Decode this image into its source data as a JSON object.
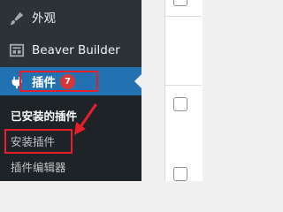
{
  "sidebar": {
    "appearance": {
      "label": "外观",
      "icon": "paintbrush-icon"
    },
    "beaver_builder": {
      "label": "Beaver Builder",
      "icon": "layout-grid-icon"
    },
    "plugins": {
      "label": "插件",
      "icon": "plugin-icon",
      "badge": "7"
    }
  },
  "submenu": {
    "installed": "已安装的插件",
    "add_new": "安装插件",
    "editor": "插件编辑器"
  },
  "colors": {
    "sidebar_bg": "#2c3338",
    "submenu_bg": "#1d2327",
    "active_bg": "#2271b1",
    "badge_bg": "#d63638",
    "annotation": "#e6202a"
  }
}
